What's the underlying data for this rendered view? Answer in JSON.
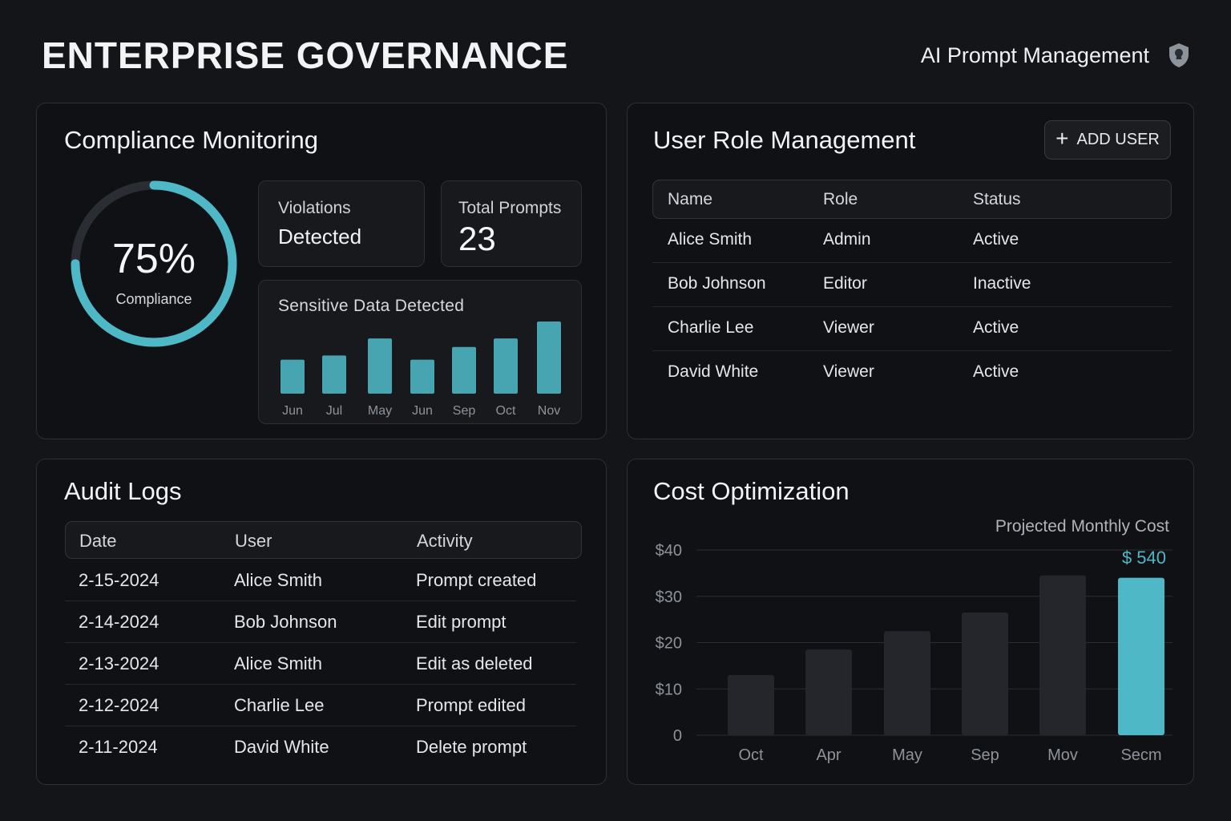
{
  "header": {
    "title": "ENTERPRISE GOVERNANCE",
    "subtitle": "AI Prompt Management",
    "icon": "shield-icon"
  },
  "colors": {
    "accent": "#4fb8c6",
    "background": "#141518",
    "card": "#101114",
    "bar_muted": "#24262b"
  },
  "compliance": {
    "title": "Compliance Monitoring",
    "percent": 75,
    "percent_label": "75%",
    "percent_caption": "Compliance",
    "violations_label": "Violations",
    "violations_value": "Detected",
    "total_label": "Total Prompts",
    "total_value": "23",
    "sensitive_title": "Sensitive Data Detected"
  },
  "users": {
    "title": "User Role Management",
    "add_button": "ADD USER",
    "columns": [
      "Name",
      "Role",
      "Status"
    ],
    "rows": [
      [
        "Alice Smith",
        "Admin",
        "Active"
      ],
      [
        "Bob Johnson",
        "Editor",
        "Inactive"
      ],
      [
        "Charlie Lee",
        "Viewer",
        "Active"
      ],
      [
        "David White",
        "Viewer",
        "Active"
      ]
    ]
  },
  "audit": {
    "title": "Audit Logs",
    "columns": [
      "Date",
      "User",
      "Activity"
    ],
    "rows": [
      [
        "2-15-2024",
        "Alice Smith",
        "Prompt created"
      ],
      [
        "2-14-2024",
        "Bob Johnson",
        "Edit prompt"
      ],
      [
        "2-13-2024",
        "Alice Smith",
        "Edit as deleted"
      ],
      [
        "2-12-2024",
        "Charlie Lee",
        "Prompt edited"
      ],
      [
        "2-11-2024",
        "David White",
        "Delete prompt"
      ]
    ]
  },
  "cost": {
    "title": "Cost Optimization"
  },
  "chart_data": [
    {
      "type": "bar",
      "title": "Sensitive Data Detected",
      "categories": [
        "Jun",
        "Jul",
        "May",
        "Jun",
        "Sep",
        "Oct",
        "Nov"
      ],
      "values": [
        4,
        4.5,
        6.5,
        4,
        5.5,
        6.5,
        8.5
      ],
      "ylim": [
        0,
        8.5
      ]
    },
    {
      "type": "bar",
      "title": "Cost Optimization",
      "categories": [
        "Oct",
        "Apr",
        "May",
        "Sep",
        "Mov",
        "Secm"
      ],
      "values": [
        13,
        18.5,
        22.5,
        26.5,
        34.5,
        34
      ],
      "highlight_index": 5,
      "ylim": [
        0,
        40
      ],
      "yticks": [
        "0",
        "$10",
        "$20",
        "$30",
        "$40"
      ],
      "ytick_values": [
        0,
        10,
        20,
        30,
        40
      ],
      "annotation_label": "Projected Monthly Cost",
      "annotation_value": "$ 540",
      "grid": true
    }
  ]
}
